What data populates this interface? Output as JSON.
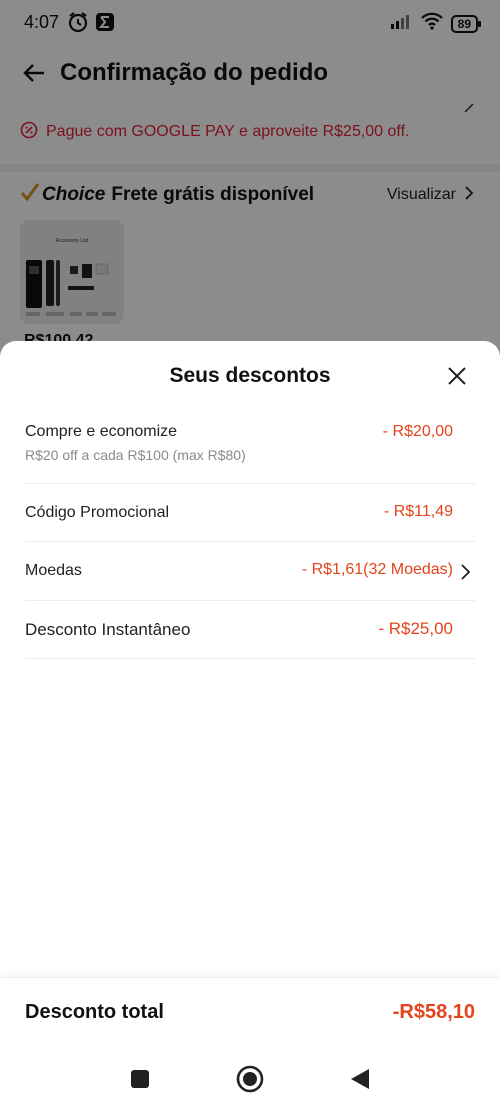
{
  "status_bar": {
    "time": "4:07",
    "battery": "89"
  },
  "app_bar": {
    "title": "Confirmação do pedido"
  },
  "promo_banner": {
    "text": "Pague com GOOGLE PAY e aproveite R$25,00 off."
  },
  "shipping": {
    "brand": "Choice",
    "free_shipping": "Frete grátis disponível",
    "view_label": "Visualizar"
  },
  "product": {
    "thumb_caption": "Accessory List",
    "price": "R$100,42"
  },
  "discount_sheet": {
    "title": "Seus descontos",
    "items": [
      {
        "label": "Compre e economize",
        "sub": "R$20 off a cada R$100 (max R$80)",
        "amount": "- R$20,00"
      },
      {
        "label": "Código Promocional",
        "amount": "- R$11,49"
      },
      {
        "label": "Moedas",
        "amount": "- R$1,61(32 Moedas)"
      },
      {
        "label": "Desconto Instantâneo",
        "amount": "- R$25,00"
      }
    ],
    "total_label": "Desconto total",
    "total_value": "-R$58,10"
  },
  "colors": {
    "accent": "#e4431b",
    "promo_red": "#e0233a",
    "choice_gold": "#d9961b"
  },
  "icons": [
    "alarm-icon",
    "sigma-icon",
    "signal-icon",
    "wifi-icon",
    "battery-icon",
    "back-arrow-icon",
    "coupon-icon",
    "check-icon",
    "chevron-right-icon",
    "close-icon",
    "nav-recents-icon",
    "nav-home-icon",
    "nav-back-icon"
  ]
}
